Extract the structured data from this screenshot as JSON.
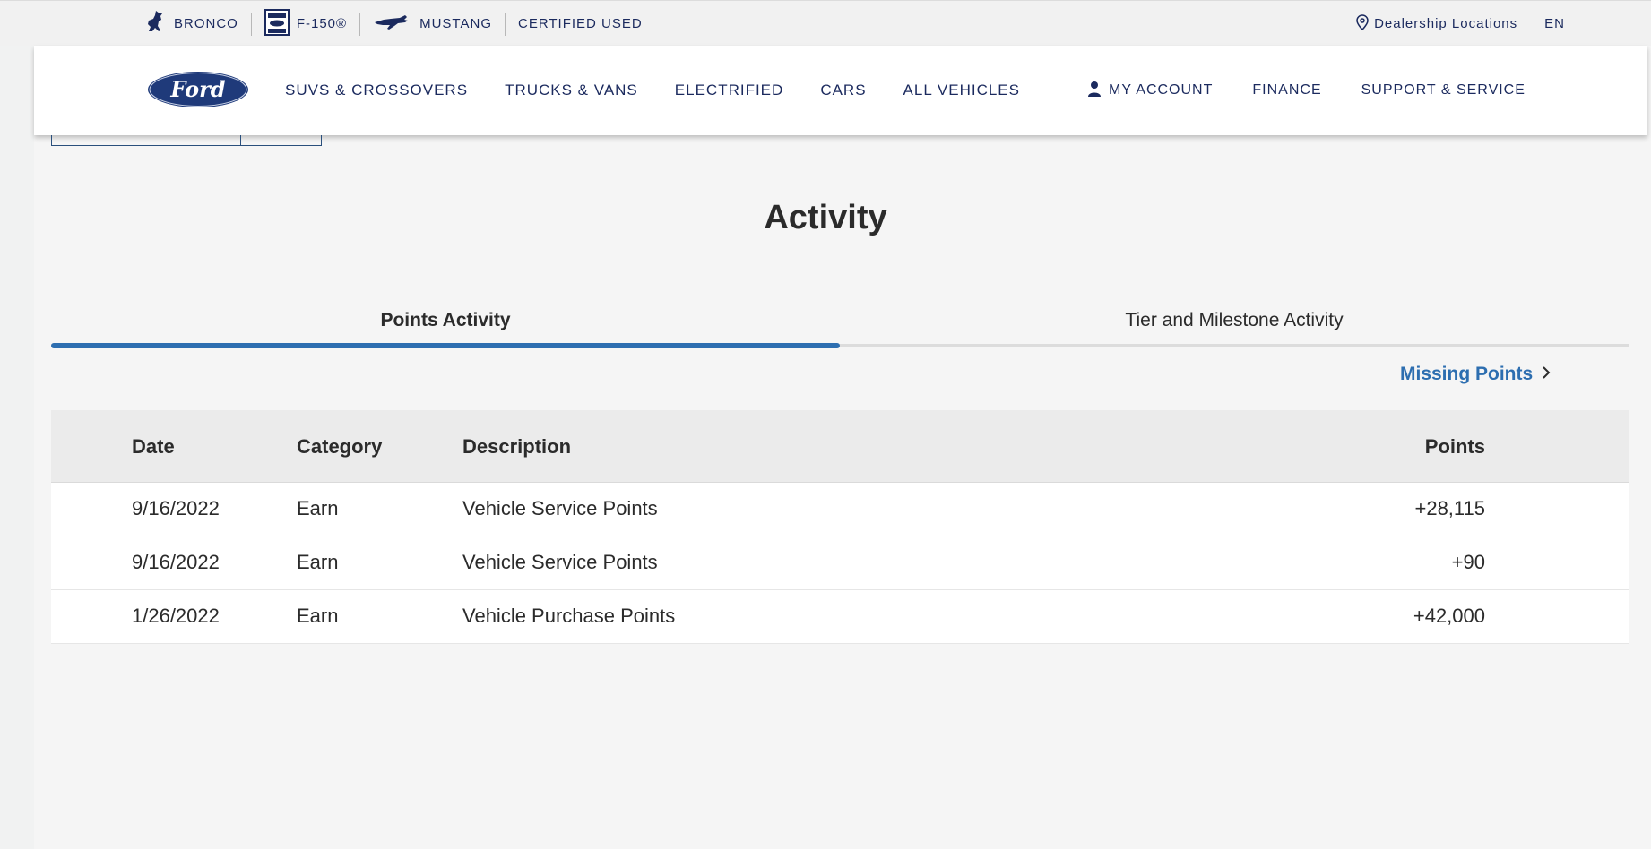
{
  "utility_bar": {
    "brands": [
      {
        "label": "BRONCO",
        "icon": "bronco-horse-icon"
      },
      {
        "label": "F-150®",
        "icon": "built-ford-tough-icon"
      },
      {
        "label": "MUSTANG",
        "icon": "mustang-pony-icon"
      },
      {
        "label": "CERTIFIED USED",
        "icon": ""
      }
    ],
    "dealership": "Dealership Locations",
    "language": "EN"
  },
  "nav": {
    "logo_text": "Ford",
    "items": [
      "SUVS & CROSSOVERS",
      "TRUCKS & VANS",
      "ELECTRIFIED",
      "CARS",
      "ALL VEHICLES"
    ],
    "account": "MY ACCOUNT",
    "finance": "FINANCE",
    "support": "SUPPORT & SERVICE"
  },
  "page": {
    "title": "Activity",
    "tabs": [
      {
        "label": "Points Activity",
        "active": true
      },
      {
        "label": "Tier and Milestone Activity",
        "active": false
      }
    ],
    "missing_points": "Missing Points"
  },
  "table": {
    "headers": {
      "date": "Date",
      "category": "Category",
      "description": "Description",
      "points": "Points"
    },
    "rows": [
      {
        "date": "9/16/2022",
        "category": "Earn",
        "description": "Vehicle Service Points",
        "points": "+28,115"
      },
      {
        "date": "9/16/2022",
        "category": "Earn",
        "description": "Vehicle Service Points",
        "points": "+90"
      },
      {
        "date": "1/26/2022",
        "category": "Earn",
        "description": "Vehicle Purchase Points",
        "points": "+42,000"
      }
    ]
  },
  "colors": {
    "brand_navy": "#1b2a5e",
    "accent_blue": "#2d6eb0",
    "ford_blue": "#1f3a7a"
  }
}
